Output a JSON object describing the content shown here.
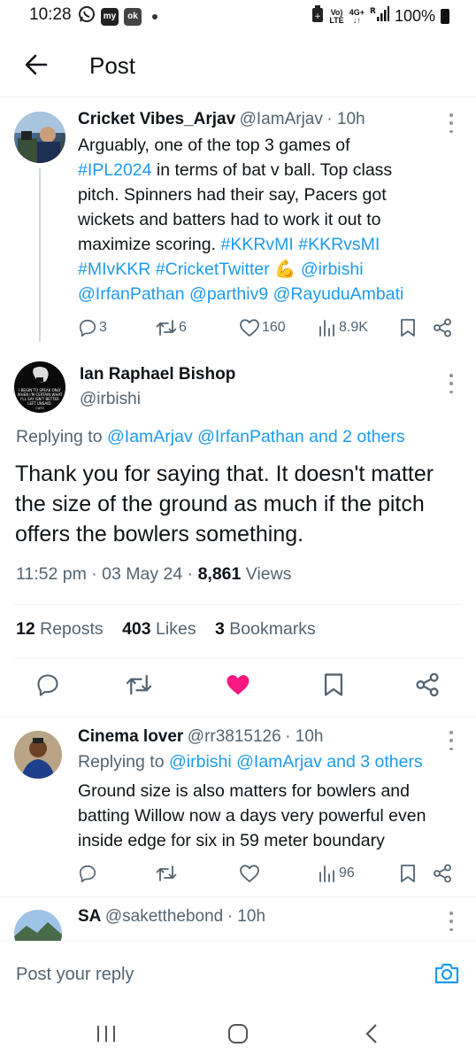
{
  "status_bar": {
    "time": "10:28",
    "left_icons": [
      "whatsapp-icon",
      "my-icon",
      "ok-icon"
    ],
    "signal_a": "Vo)",
    "signal_a2": "LTE",
    "signal_b": "4G+",
    "signal_b2": "R",
    "battery": "100%"
  },
  "header": {
    "title": "Post"
  },
  "parent_tweet": {
    "name": "Cricket Vibes_Arjav",
    "handle": "@IamArjav",
    "time": "· 10h",
    "lines": [
      [
        {
          "t": "Arguably, one of the top 3 games of"
        }
      ],
      [
        {
          "t": "#IPL2024",
          "link": true
        },
        {
          "t": " in terms of bat v ball. Top class"
        }
      ],
      [
        {
          "t": "pitch. Spinners had their say, Pacers got"
        }
      ],
      [
        {
          "t": "wickets and batters had to work it out to"
        }
      ],
      [
        {
          "t": "maximize scoring. "
        },
        {
          "t": "#KKRvMI #KKRvsMI",
          "link": true
        }
      ],
      [
        {
          "t": "#MIvKKR #CricketTwitter",
          "link": true
        },
        {
          "t": " 💪 "
        },
        {
          "t": "@irbishi",
          "link": true
        }
      ],
      [
        {
          "t": "@IrfanPathan @parthiv9 @RayuduAmbati",
          "link": true
        }
      ]
    ],
    "replies": "3",
    "reposts": "6",
    "likes": "160",
    "views": "8.9K"
  },
  "main_tweet": {
    "name": "Ian Raphael Bishop",
    "handle": "@irbishi",
    "avatar_text": "I BEGIN TO SPEAK ONLY WHEN I'M CERTAIN WHAT I'LL SAY ISN'T BETTER LEFT UNSAID. CATO",
    "replying_prefix": "Replying to ",
    "replying_to": "@IamArjav @IrfanPathan and 2 others",
    "text_lines": [
      "Thank you for saying that. It doesn't matter",
      "the size of the ground as much if the pitch",
      "offers the bowlers something."
    ],
    "time": "11:52 pm · 03 May 24 · ",
    "views_count": "8,861",
    "views_label": " Views",
    "stats": [
      {
        "count": "12",
        "label": " Reposts"
      },
      {
        "count": "403",
        "label": " Likes"
      },
      {
        "count": "3",
        "label": " Bookmarks"
      }
    ],
    "liked_color": "#f91880"
  },
  "reply_1": {
    "name": "Cinema lover",
    "handle": "@rr3815126",
    "time": "· 10h",
    "replying_prefix": "Replying to ",
    "replying_to": "@irbishi @IamArjav and 3 others",
    "text_lines": [
      "Ground size is also matters for bowlers and",
      "batting Willow now a days very powerful even",
      "inside edge for six in 59 meter boundary"
    ],
    "views": "96"
  },
  "reply_2": {
    "name": "SA",
    "handle": "@saketthebond",
    "time": "· 10h"
  },
  "reply_bar": {
    "placeholder": "Post your reply"
  },
  "accent": "#1d9bf0"
}
